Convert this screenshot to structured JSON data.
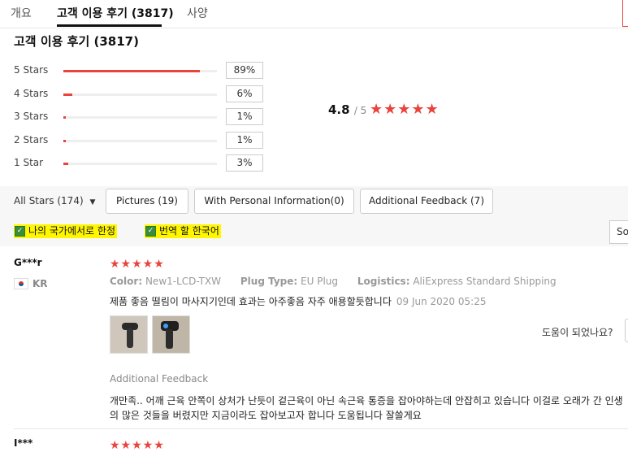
{
  "tabs": [
    {
      "label": "개요"
    },
    {
      "label": "고객 이용 후기 (3817)"
    },
    {
      "label": "사양"
    }
  ],
  "summary": {
    "title": "고객 이용 후기 (3817)",
    "rows": [
      {
        "label": "5 Stars",
        "pct": "89%",
        "fill": 0.89
      },
      {
        "label": "4 Stars",
        "pct": "6%",
        "fill": 0.06
      },
      {
        "label": "3 Stars",
        "pct": "1%",
        "fill": 0.01
      },
      {
        "label": "2 Stars",
        "pct": "1%",
        "fill": 0.01
      },
      {
        "label": "1 Star",
        "pct": "3%",
        "fill": 0.03
      }
    ],
    "average": "4.8",
    "out_of": "/ 5",
    "stars": "★★★★★"
  },
  "filters": {
    "all_stars": "All Stars (174)",
    "buttons": [
      {
        "label": "Pictures (19)"
      },
      {
        "label": "With Personal Information(0)"
      },
      {
        "label": "Additional Feedback (7)"
      }
    ],
    "checkbox_country": "나의 국가에서로 한정",
    "checkbox_translate": "번역 할 한국어",
    "sort_label": "So"
  },
  "review": {
    "user": "G***r",
    "country": "KR",
    "stars": "★★★★★",
    "color_label": "Color:",
    "color_value": "New1-LCD-TXW",
    "plug_label": "Plug Type:",
    "plug_value": "EU Plug",
    "logistics_label": "Logistics:",
    "logistics_value": "AliExpress Standard Shipping",
    "text": "제품 좋음 떨림이 마사지기인데 효과는 아주좋음 자주 애용할듯합니다",
    "date": "09 Jun 2020 05:25",
    "helpful_label": "도움이 되었나요?",
    "additional_title": "Additional Feedback",
    "additional_text": "개만족.. 어깨 근육 안쪽이 상처가 난듯이 겉근육이 아닌 속근육 통증을 잡아야하는데 안잡히고 있습니다 이걸로 오래가 간 인생의 많은 것들을 버렸지만 지금이라도 잡아보고자 합니다 도움됩니다 잘쓸게요"
  },
  "next_review": {
    "user": "I***",
    "stars": "★★★★★"
  },
  "colors": {
    "accent": "#e9433c",
    "highlight": "#fff600"
  }
}
